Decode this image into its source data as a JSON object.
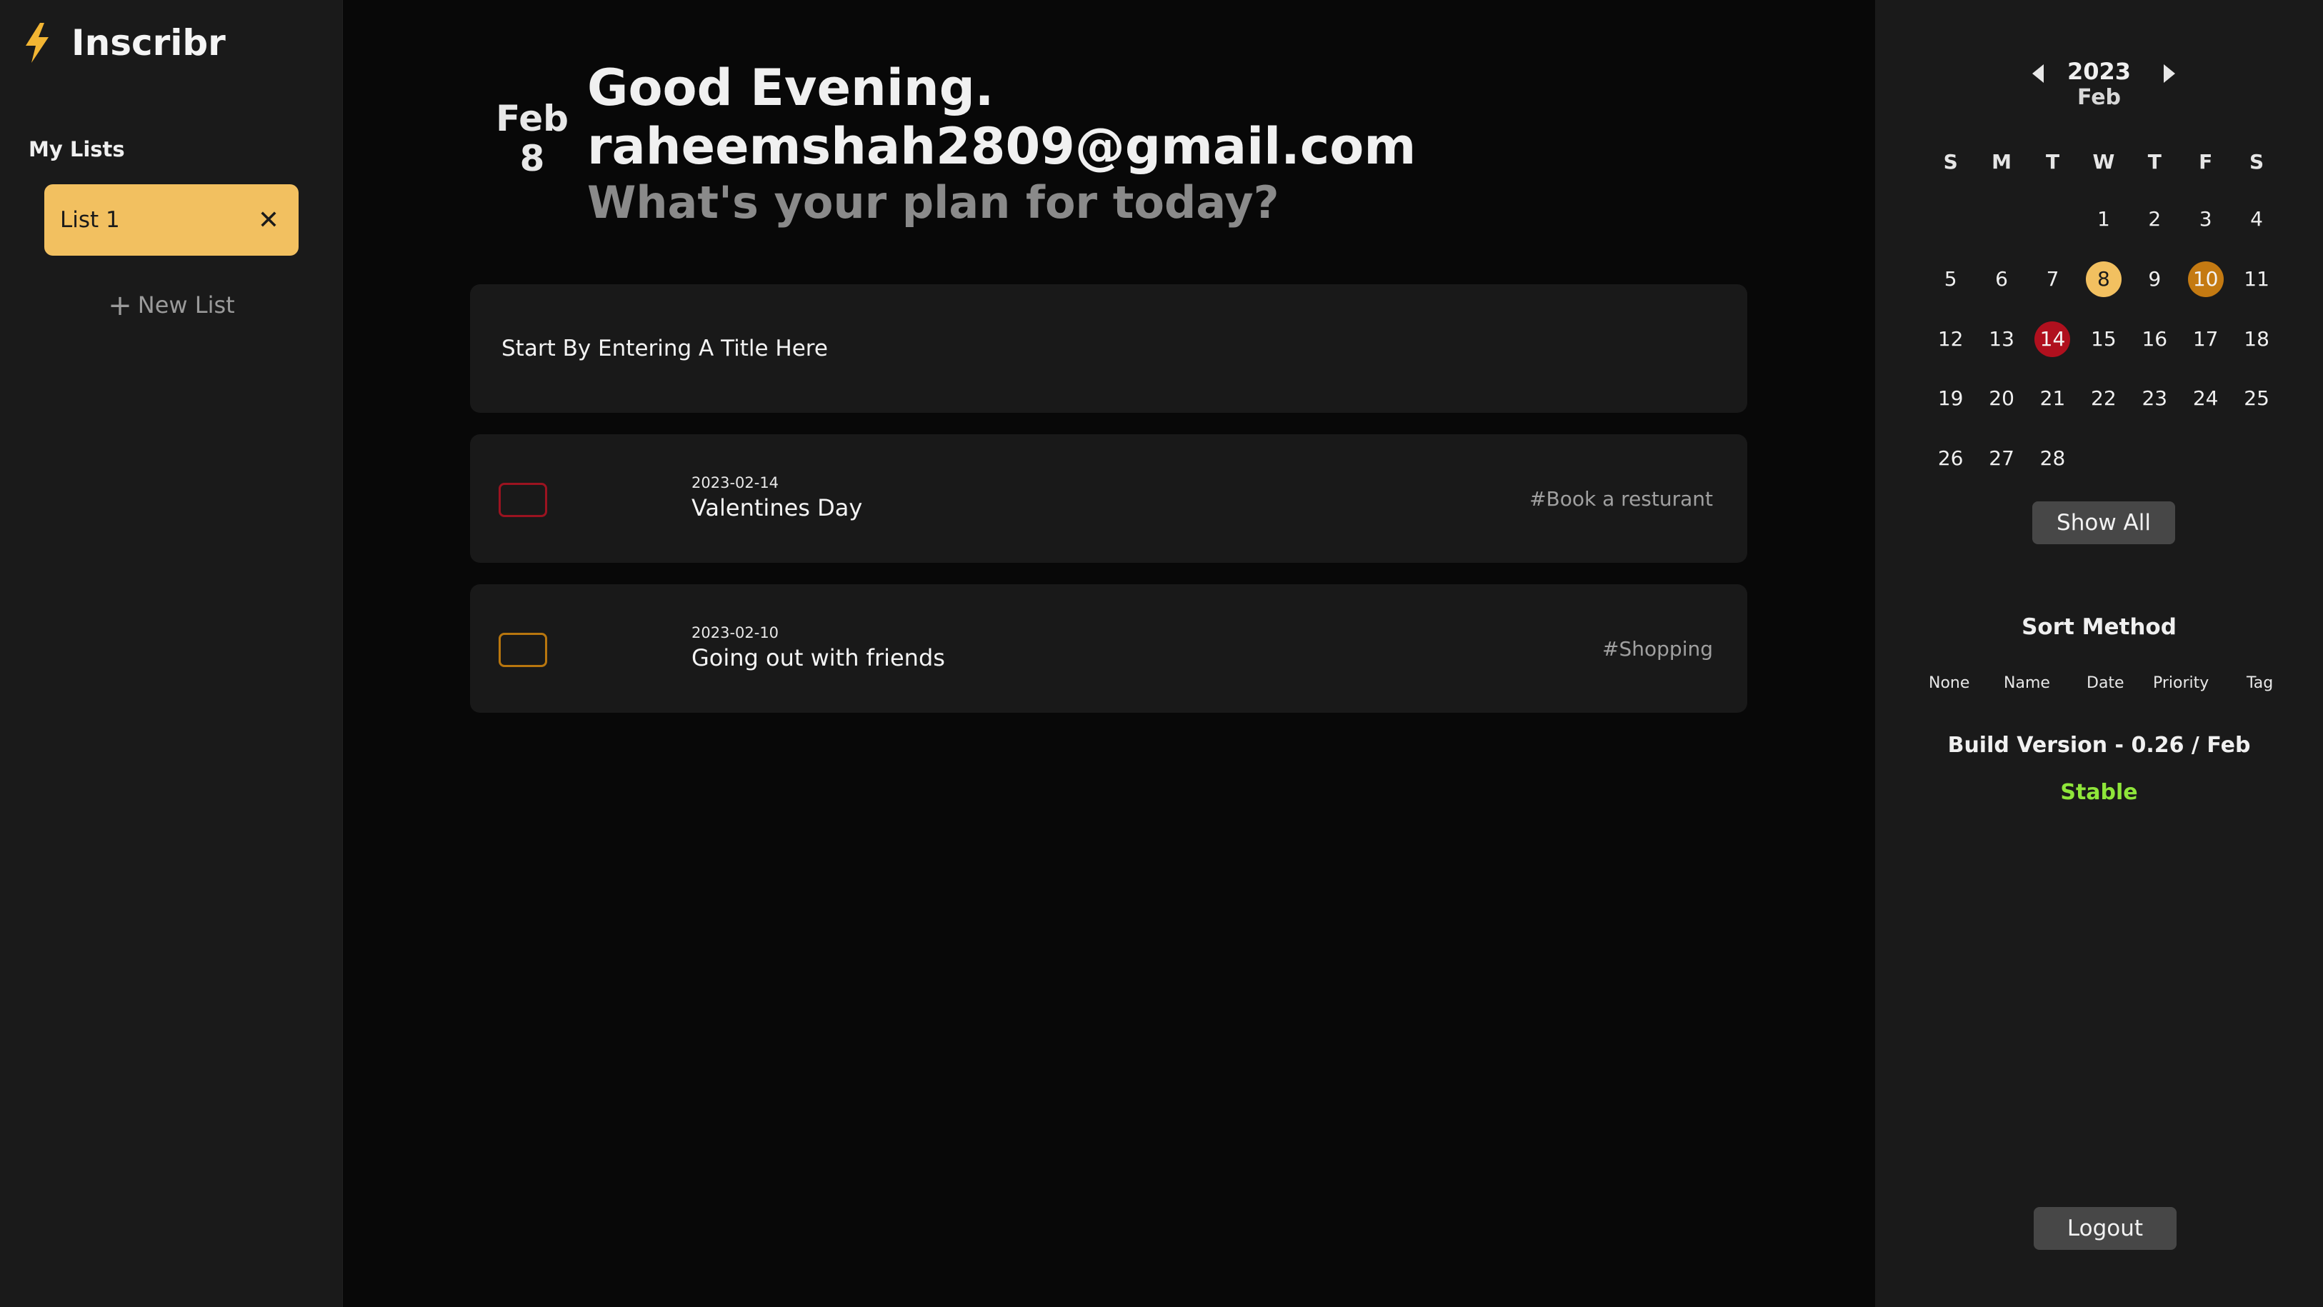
{
  "app": {
    "name": "Inscribr",
    "logo_icon": "lightning-bolt-icon"
  },
  "sidebar": {
    "heading": "My Lists",
    "lists": [
      {
        "label": "List 1",
        "close_glyph": "✕"
      }
    ],
    "new_list": {
      "plus": "+",
      "label": "New List"
    }
  },
  "header": {
    "month": "Feb",
    "day": "8",
    "greeting": "Good Evening.",
    "email": "raheemshah2809@gmail.com",
    "subtitle": "What's your plan for today?"
  },
  "title_input": {
    "placeholder": "Start By Entering A Title Here",
    "value": ""
  },
  "tasks": [
    {
      "date": "2023-02-14",
      "title": "Valentines Day",
      "tag": "#Book a resturant",
      "color": "#9b1320"
    },
    {
      "date": "2023-02-10",
      "title": "Going out with friends",
      "tag": "#Shopping",
      "color": "#b8760e"
    }
  ],
  "calendar": {
    "year": "2023",
    "month": "Feb",
    "weekdays": [
      "S",
      "M",
      "T",
      "W",
      "T",
      "F",
      "S"
    ],
    "first_weekday_index": 3,
    "days_in_month": 28,
    "highlights": [
      {
        "day": 8,
        "bg": "#f2c060",
        "fg": "#1a1a1a"
      },
      {
        "day": 10,
        "bg": "#c47a12",
        "fg": "#f4f4f4"
      },
      {
        "day": 14,
        "bg": "#b0101e",
        "fg": "#f4f4f4"
      }
    ],
    "show_all_label": "Show All"
  },
  "sort": {
    "title": "Sort Method",
    "options": [
      "None",
      "Name",
      "Date",
      "Priority",
      "Tag"
    ]
  },
  "build": {
    "label": "Build Version - 0.26 / Feb",
    "status": "Stable",
    "status_color": "#8fe63a"
  },
  "logout_label": "Logout"
}
